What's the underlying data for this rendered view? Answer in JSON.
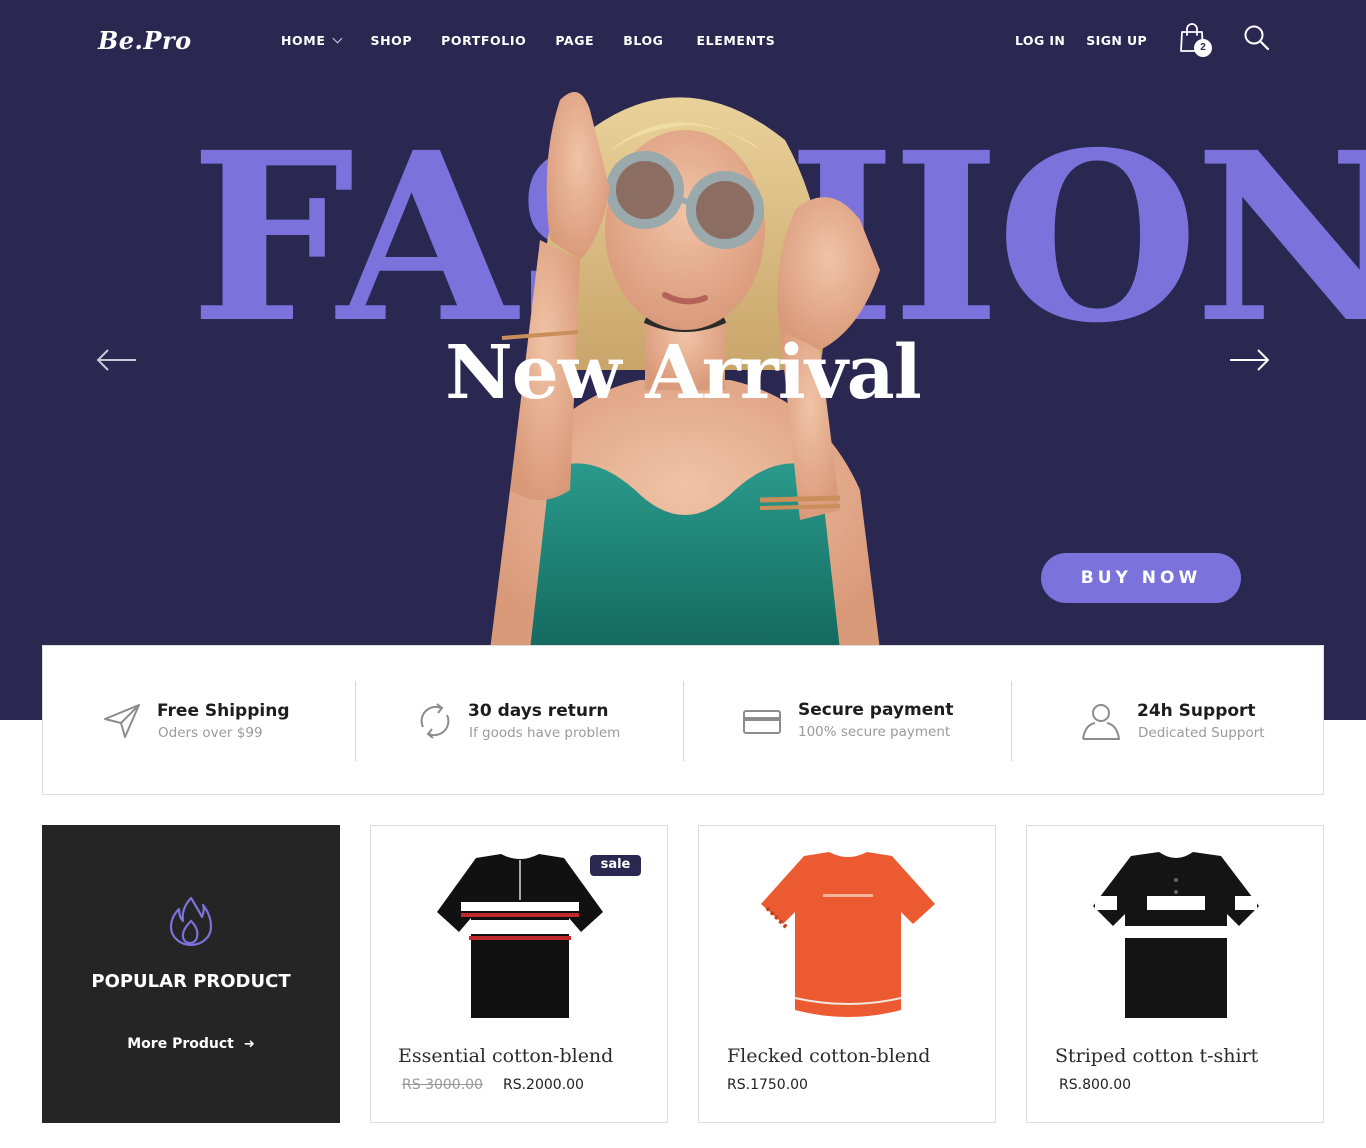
{
  "brand": {
    "logo": "Be.Pro"
  },
  "nav": {
    "items": [
      {
        "label": "HOME",
        "has_dropdown": true
      },
      {
        "label": "SHOP"
      },
      {
        "label": "PORTFOLIO"
      },
      {
        "label": "PAGE"
      },
      {
        "label": "BLOG"
      },
      {
        "label": "ELEMENTS"
      }
    ],
    "login": "LOG IN",
    "signup": "SIGN UP",
    "cart_count": "2",
    "icons": {
      "cart": "shopping-bag-icon",
      "search": "search-icon"
    }
  },
  "hero": {
    "background_word": "FASHION",
    "headline": "New Arrival",
    "cta": "BUY NOW",
    "colors": {
      "background": "#2a2751",
      "accent": "#7b73db"
    },
    "icons": {
      "prev": "arrow-left-icon",
      "next": "arrow-right-icon"
    }
  },
  "features": [
    {
      "icon": "paper-plane-icon",
      "title": "Free Shipping",
      "subtitle": "Oders over $99"
    },
    {
      "icon": "refresh-icon",
      "title": "30 days return",
      "subtitle": "If goods have problem"
    },
    {
      "icon": "credit-card-icon",
      "title": "Secure payment",
      "subtitle": "100% secure payment"
    },
    {
      "icon": "user-icon",
      "title": "24h Support",
      "subtitle": "Dedicated Support"
    }
  ],
  "popular": {
    "icon": "flame-icon",
    "title": "POPULAR PRODUCT",
    "link": "More Product",
    "link_icon": "arrow-right-icon"
  },
  "products": [
    {
      "name": "Essential cotton-blend",
      "old_price": "RS 3000.00",
      "price": "RS.2000.00",
      "badge": "sale",
      "color": "black-red-stripe"
    },
    {
      "name": "Flecked cotton-blend",
      "old_price": "",
      "price": "RS.1750.00",
      "badge": "",
      "color": "orange"
    },
    {
      "name": "Striped cotton t-shirt",
      "old_price": "",
      "price": "RS.800.00",
      "badge": "",
      "color": "black-white-stripe"
    }
  ]
}
